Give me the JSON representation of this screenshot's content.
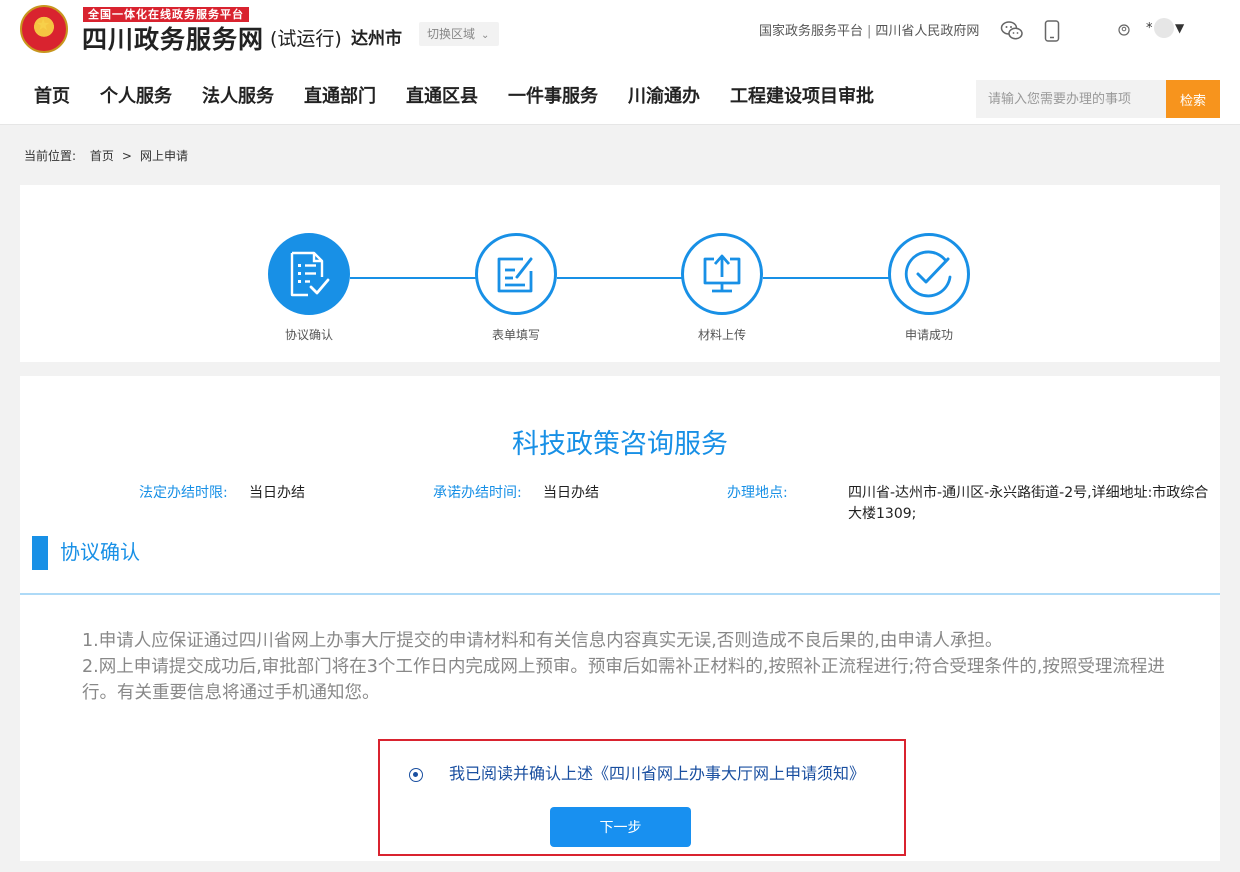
{
  "header": {
    "platform_tag": "全国一体化在线政务服务平台",
    "site_name": "四川政务服务网",
    "trial": "(试运行)",
    "city": "达州市",
    "switch_region": "切换区域",
    "top_links": [
      "国家政务服务平台",
      "四川省人民政府网"
    ],
    "top_links_separator": "|",
    "user_name": "*",
    "icons": [
      "national-emblem-icon",
      "wechat-icon",
      "mobile-icon",
      "user-icon",
      "chevron-down-icon"
    ]
  },
  "nav": {
    "items": [
      "首页",
      "个人服务",
      "法人服务",
      "直通部门",
      "直通区县",
      "一件事服务",
      "川渝通办",
      "工程建设项目审批"
    ]
  },
  "search": {
    "placeholder": "请输入您需要办理的事项",
    "button_label": "检索"
  },
  "breadcrumb": {
    "label": "当前位置:",
    "items": [
      "首页",
      "网上申请"
    ],
    "separator": ">"
  },
  "steps": [
    {
      "label": "协议确认",
      "icon": "document-check-icon",
      "active": true
    },
    {
      "label": "表单填写",
      "icon": "form-edit-icon",
      "active": false
    },
    {
      "label": "材料上传",
      "icon": "upload-monitor-icon",
      "active": false
    },
    {
      "label": "申请成功",
      "icon": "success-check-icon",
      "active": false
    }
  ],
  "service": {
    "title": "科技政策咨询服务",
    "legal_time_label": "法定办结时限:",
    "legal_time_value": "当日办结",
    "promise_time_label": "承诺办结时间:",
    "promise_time_value": "当日办结",
    "location_label": "办理地点:",
    "location_value": "四川省-达州市-通川区-永兴路街道-2号,详细地址:市政综合大楼1309;"
  },
  "section": {
    "title": "协议确认"
  },
  "terms": [
    "1.申请人应保证通过四川省网上办事大厅提交的申请材料和有关信息内容真实无误,否则造成不良后果的,由申请人承担。",
    "2.网上申请提交成功后,审批部门将在3个工作日内完成网上预审。预审后如需补正材料的,按照补正流程进行;符合受理条件的,按照受理流程进行。有关重要信息将通过手机通知您。"
  ],
  "confirm": {
    "text": "我已阅读并确认上述《四川省网上办事大厅网上申请须知》",
    "checked": true,
    "next_label": "下一步"
  },
  "colors": {
    "primary": "#1890e6",
    "brand_red": "#d9232f",
    "search_orange": "#f7941d",
    "confirm_text": "#1a4fa0"
  }
}
